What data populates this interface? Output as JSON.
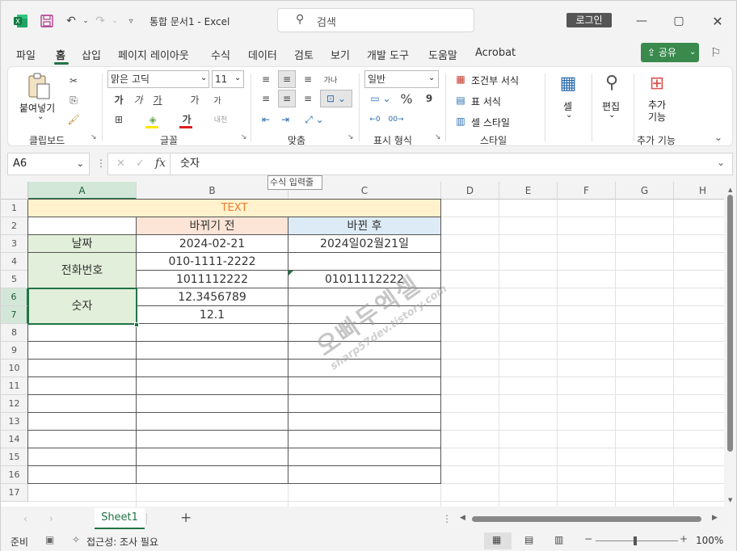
{
  "titlebar": {
    "app_icon": "excel-logo",
    "title": "통합 문서1  -  Excel",
    "search_placeholder": "검색",
    "login_label": "로그인",
    "icons": [
      "save-icon",
      "undo-icon",
      "redo-icon",
      "customize-qat-icon",
      "minimize-icon",
      "maximize-icon",
      "close-icon"
    ]
  },
  "menu": {
    "tabs": [
      "파일",
      "홈",
      "삽입",
      "페이지 레이아웃",
      "수식",
      "데이터",
      "검토",
      "보기",
      "개발 도구",
      "도움말",
      "Acrobat"
    ],
    "active": "홈",
    "share_label": "공유"
  },
  "ribbon": {
    "clipboard": {
      "paste_label": "붙여넣기",
      "group_label": "클립보드"
    },
    "font": {
      "font_name": "맑은 고딕",
      "font_size": "11",
      "group_label": "글꼴",
      "bold": "가",
      "italic": "가",
      "underline": "가",
      "grow": "가",
      "shrink": "가",
      "font_color_char": "가",
      "phonetic": "내천"
    },
    "alignment": {
      "group_label": "맞춤",
      "wrap": "가나"
    },
    "number": {
      "format": "일반",
      "group_label": "표시 형식",
      "percent": "%",
      "comma": "9"
    },
    "styles": {
      "conditional": "조건부 서식",
      "table": "표 서식",
      "cell_style": "셀 스타일",
      "group_label": "스타일"
    },
    "cells": {
      "label": "셀"
    },
    "editing": {
      "label": "편집"
    },
    "addins": {
      "label": "추가\n기능",
      "group_label": "추가 기능"
    }
  },
  "formula_bar": {
    "name_box": "A6",
    "formula": "숫자",
    "fx": "fx",
    "tooltip": "수식 입력줄"
  },
  "columns": [
    "A",
    "B",
    "C",
    "D",
    "E",
    "F",
    "G",
    "H"
  ],
  "rows": [
    "1",
    "2",
    "3",
    "4",
    "5",
    "6",
    "7",
    "8",
    "9",
    "10",
    "11",
    "12",
    "13",
    "14",
    "15",
    "16",
    "17"
  ],
  "cells": {
    "title": "TEXT",
    "b2": "바뀌기 전",
    "c2": "바뀐 후",
    "a3": "날짜",
    "b3": "2024-02-21",
    "c3": "2024일02월21일",
    "a4": "전화번호",
    "b4": "010-1111-2222",
    "b5": "1011112222",
    "c5": "01011112222",
    "a6": "숫자",
    "b6": "12.3456789",
    "b7": "12.1"
  },
  "watermark": {
    "line1": "오빠두엑셀",
    "line2": "sharp57dev.tistory.com"
  },
  "sheets": {
    "active": "Sheet1",
    "add": "+"
  },
  "status": {
    "ready": "준비",
    "accessibility": "접근성: 조사 필요",
    "zoom": "100%",
    "minus": "−",
    "plus": "+"
  },
  "colors": {
    "excel_green": "#217346",
    "title_fill": "#fff2cc",
    "before_fill": "#fce4d6",
    "after_fill": "#ddebf7",
    "label_fill": "#e2efda",
    "title_text": "#ed7d31",
    "share_green": "#3a8a4e"
  }
}
